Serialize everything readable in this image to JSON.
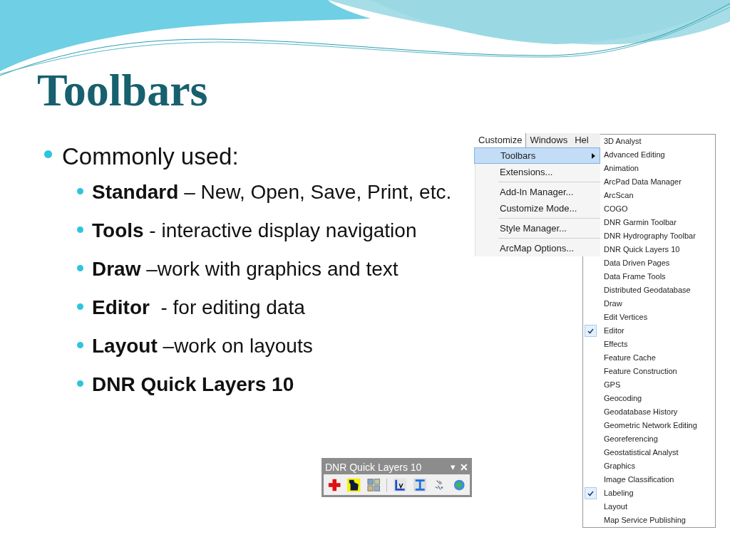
{
  "slide": {
    "title": "Toolbars",
    "bullets": [
      {
        "text": "Commonly used:",
        "children": [
          {
            "text": "**Standard** – New, Open, Save, Print, etc."
          },
          {
            "text": "**Tools** - interactive display navigation"
          },
          {
            "text": "**Draw** –work with graphics and text"
          },
          {
            "text": "**Editor**  - for editing data"
          },
          {
            "text": "**Layout** –work on layouts"
          },
          {
            "text": "**DNR Quick Layers 10**"
          }
        ]
      }
    ]
  },
  "menu_bar": {
    "items": [
      {
        "label": "Customize",
        "selected": true
      },
      {
        "label": "Windows",
        "selected": false
      },
      {
        "label": "Hel",
        "selected": false
      }
    ]
  },
  "customize_menu": {
    "items": [
      {
        "label": "Toolbars",
        "selected": true,
        "submenu": true
      },
      {
        "label": "Extensions...",
        "selected": false
      },
      {
        "kind": "separator"
      },
      {
        "label": "Add-In Manager...",
        "selected": false
      },
      {
        "label": "Customize Mode...",
        "selected": false
      },
      {
        "kind": "separator"
      },
      {
        "label": "Style Manager...",
        "selected": false
      },
      {
        "kind": "separator"
      },
      {
        "label": "ArcMap Options...",
        "selected": false
      }
    ]
  },
  "toolbars_submenu": {
    "items": [
      {
        "label": "3D Analyst",
        "checked": false
      },
      {
        "label": "Advanced Editing",
        "checked": false
      },
      {
        "label": "Animation",
        "checked": false
      },
      {
        "label": "ArcPad Data Manager",
        "checked": false
      },
      {
        "label": "ArcScan",
        "checked": false
      },
      {
        "label": "COGO",
        "checked": false
      },
      {
        "label": "DNR Garmin Toolbar",
        "checked": false
      },
      {
        "label": "DNR Hydrography Toolbar",
        "checked": false
      },
      {
        "label": "DNR Quick Layers 10",
        "checked": false
      },
      {
        "label": "Data Driven Pages",
        "checked": false
      },
      {
        "label": "Data Frame Tools",
        "checked": false
      },
      {
        "label": "Distributed Geodatabase",
        "checked": false
      },
      {
        "label": "Draw",
        "checked": false
      },
      {
        "label": "Edit Vertices",
        "checked": false
      },
      {
        "label": "Editor",
        "checked": true
      },
      {
        "label": "Effects",
        "checked": false
      },
      {
        "label": "Feature Cache",
        "checked": false
      },
      {
        "label": "Feature Construction",
        "checked": false
      },
      {
        "label": "GPS",
        "checked": false
      },
      {
        "label": "Geocoding",
        "checked": false
      },
      {
        "label": "Geodatabase History",
        "checked": false
      },
      {
        "label": "Geometric Network Editing",
        "checked": false
      },
      {
        "label": "Georeferencing",
        "checked": false
      },
      {
        "label": "Geostatistical Analyst",
        "checked": false
      },
      {
        "label": "Graphics",
        "checked": false
      },
      {
        "label": "Image Classification",
        "checked": false
      },
      {
        "label": "Labeling",
        "checked": true
      },
      {
        "label": "Layout",
        "checked": false
      },
      {
        "label": "Map Service Publishing",
        "checked": false
      }
    ]
  },
  "quick_layers_toolbar": {
    "title": "DNR Quick Layers 10",
    "dropdown": "▾",
    "close": "✕",
    "tools": [
      {
        "kind": "add"
      },
      {
        "kind": "state-map"
      },
      {
        "kind": "grid"
      },
      {
        "kind": "separator"
      },
      {
        "kind": "lv"
      },
      {
        "kind": "ibeam"
      },
      {
        "kind": "sparkle"
      },
      {
        "kind": "globe"
      }
    ]
  }
}
